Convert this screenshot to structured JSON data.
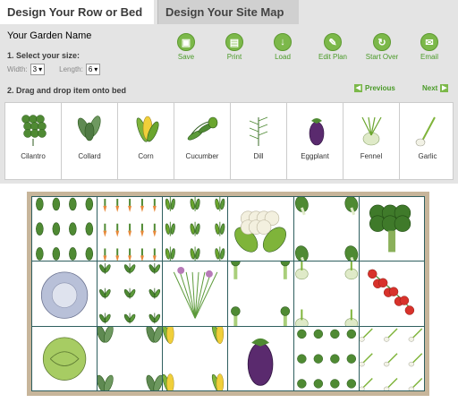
{
  "tabs": [
    {
      "label": "Design Your Row or Bed",
      "active": true
    },
    {
      "label": "Design Your Site Map",
      "active": false
    }
  ],
  "garden_name": "Your Garden Name",
  "steps": {
    "size": "1. Select your size:",
    "drag": "2. Drag and drop item onto bed"
  },
  "size": {
    "width_label": "Width:",
    "width_value": "3",
    "length_label": "Length:",
    "length_value": "6"
  },
  "toolbar": [
    {
      "label": "Save",
      "icon": "floppy-icon"
    },
    {
      "label": "Print",
      "icon": "printer-icon"
    },
    {
      "label": "Load",
      "icon": "download-arrow-icon"
    },
    {
      "label": "Edit Plan",
      "icon": "pencil-icon"
    },
    {
      "label": "Start Over",
      "icon": "refresh-icon"
    },
    {
      "label": "Email",
      "icon": "envelope-icon"
    }
  ],
  "nav": {
    "previous": "Previous",
    "next": "Next"
  },
  "palette": [
    {
      "label": "Cilantro",
      "plant": "cilantro"
    },
    {
      "label": "Collard",
      "plant": "collard"
    },
    {
      "label": "Corn",
      "plant": "corn"
    },
    {
      "label": "Cucumber",
      "plant": "cucumber"
    },
    {
      "label": "Dill",
      "plant": "dill"
    },
    {
      "label": "Eggplant",
      "plant": "eggplant"
    },
    {
      "label": "Fennel",
      "plant": "fennel"
    },
    {
      "label": "Garlic",
      "plant": "garlic"
    }
  ],
  "bed": [
    [
      "leafy",
      "carrot",
      "bean",
      "cauliflower",
      "bokchoy",
      "broccoli"
    ],
    [
      "cabbage",
      "herb",
      "chives",
      "celery",
      "fennel",
      "tomato"
    ],
    [
      "brussels",
      "collard",
      "corn",
      "eggplant",
      "cilantro",
      "garlic"
    ]
  ],
  "colors": {
    "accent": "#7cb84a",
    "bed_frame": "#c7b59a",
    "grid": "#2f5f5f"
  }
}
